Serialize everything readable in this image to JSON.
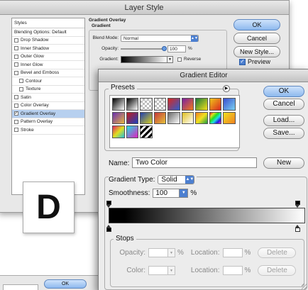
{
  "layer_style": {
    "title": "Layer Style",
    "sidebar": {
      "header": "Styles",
      "items": [
        {
          "label": "Blending Options: Default",
          "checkbox": false,
          "checked": false,
          "indent": false,
          "selected": false
        },
        {
          "label": "Drop Shadow",
          "checkbox": true,
          "checked": false,
          "indent": false,
          "selected": false
        },
        {
          "label": "Inner Shadow",
          "checkbox": true,
          "checked": false,
          "indent": false,
          "selected": false
        },
        {
          "label": "Outer Glow",
          "checkbox": true,
          "checked": false,
          "indent": false,
          "selected": false
        },
        {
          "label": "Inner Glow",
          "checkbox": true,
          "checked": false,
          "indent": false,
          "selected": false
        },
        {
          "label": "Bevel and Emboss",
          "checkbox": true,
          "checked": false,
          "indent": false,
          "selected": false
        },
        {
          "label": "Contour",
          "checkbox": true,
          "checked": false,
          "indent": true,
          "selected": false
        },
        {
          "label": "Texture",
          "checkbox": true,
          "checked": false,
          "indent": true,
          "selected": false
        },
        {
          "label": "Satin",
          "checkbox": true,
          "checked": false,
          "indent": false,
          "selected": false
        },
        {
          "label": "Color Overlay",
          "checkbox": true,
          "checked": false,
          "indent": false,
          "selected": false
        },
        {
          "label": "Gradient Overlay",
          "checkbox": true,
          "checked": true,
          "indent": false,
          "selected": true
        },
        {
          "label": "Pattern Overlay",
          "checkbox": true,
          "checked": false,
          "indent": false,
          "selected": false
        },
        {
          "label": "Stroke",
          "checkbox": true,
          "checked": false,
          "indent": false,
          "selected": false
        }
      ]
    },
    "panel": {
      "group_title": "Gradient Overlay",
      "sub_title": "Gradient",
      "blend_mode_label": "Blend Mode:",
      "blend_mode_value": "Normal",
      "opacity_label": "Opacity:",
      "opacity_value": "100",
      "opacity_unit": "%",
      "opacity_fraction": 1.0,
      "gradient_label": "Gradient:",
      "reverse_label": "Reverse",
      "reverse_checked": false
    },
    "buttons": {
      "ok": "OK",
      "cancel": "Cancel",
      "new_style": "New Style...",
      "preview": "Preview",
      "preview_checked": true
    }
  },
  "label_letter": "D",
  "bottom_fragment": {
    "ok": "OK"
  },
  "gradient_editor": {
    "title": "Gradient Editor",
    "presets_label": "Presets",
    "presets_menu_icon": "triangle-right-icon",
    "swatches": [
      "linear-gradient(135deg,#000,#fff)",
      "linear-gradient(135deg,#000,#fff)",
      "repeating-conic-gradient(#bbb 0 25%, #fff 0 50%) 0 0/6px 6px",
      "repeating-conic-gradient(#bbb 0 25%, #fff 0 50%) 0 0/6px 6px",
      "linear-gradient(135deg,#d9281f,#2c5fd0)",
      "linear-gradient(135deg,#7a1fa1,#f37b1a)",
      "linear-gradient(135deg,#1a7a3a,#f3e01a)",
      "linear-gradient(135deg,#f0c419,#d9281f)",
      "linear-gradient(135deg,#3a4fd0,#7ad0f0)",
      "linear-gradient(135deg,#6a2fb0,#e9b640)",
      "linear-gradient(135deg,#c01e1e,#1e40c0)",
      "linear-gradient(135deg,#2040b0,#d8d020)",
      "linear-gradient(135deg,#c63a3a,#e6c23a)",
      "linear-gradient(135deg,#6a6a6a,#fff)",
      "linear-gradient(135deg,#e0c020,#fff)",
      "linear-gradient(135deg,#f08020,#f0e020,#20a040)",
      "linear-gradient(135deg,#e02020,#e0e020,#20e020,#20e0e0,#2020e0,#e020e0)",
      "linear-gradient(135deg,#f0e020,#f08020)",
      "linear-gradient(135deg,#e02060,#e0e020,#20c0e0)",
      "linear-gradient(135deg,#20e0e0,#e020c0)",
      "repeating-linear-gradient(135deg,#000 0 3px,#fff 3px 6px)"
    ],
    "buttons": {
      "ok": "OK",
      "cancel": "Cancel",
      "load": "Load...",
      "save": "Save...",
      "new": "New"
    },
    "name_label": "Name:",
    "name_value": "Two Color",
    "gradient_type_label": "Gradient Type:",
    "gradient_type_value": "Solid",
    "smoothness_label": "Smoothness:",
    "smoothness_value": "100",
    "smoothness_unit": "%",
    "stops": {
      "label": "Stops",
      "opacity_label": "Opacity:",
      "color_label": "Color:",
      "location_label": "Location:",
      "unit": "%",
      "delete_label": "Delete"
    },
    "colors": {
      "gradient_start": "#000000",
      "gradient_end": "#ffffff",
      "accent": "#4c7fd0"
    }
  }
}
